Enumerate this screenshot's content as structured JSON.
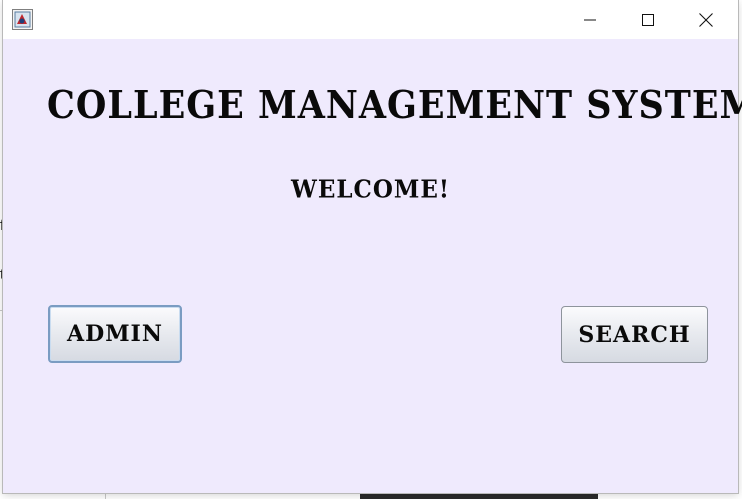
{
  "background": {
    "peek_text_1": "fi",
    "peek_text_2": "t"
  },
  "window": {
    "icon": "java-app-icon",
    "controls": {
      "minimize": "minimize-icon",
      "maximize": "maximize-icon",
      "close": "close-icon"
    }
  },
  "main": {
    "title": "COLLEGE MANAGEMENT SYSTEM",
    "welcome": "WELCOME!"
  },
  "buttons": {
    "admin_label": "ADMIN",
    "search_label": "SEARCH"
  },
  "colors": {
    "window_background": "#efeafd",
    "titlebar_background": "#ffffff",
    "focused_button_border": "#7a9cc2",
    "text": "#0a0a0a"
  }
}
